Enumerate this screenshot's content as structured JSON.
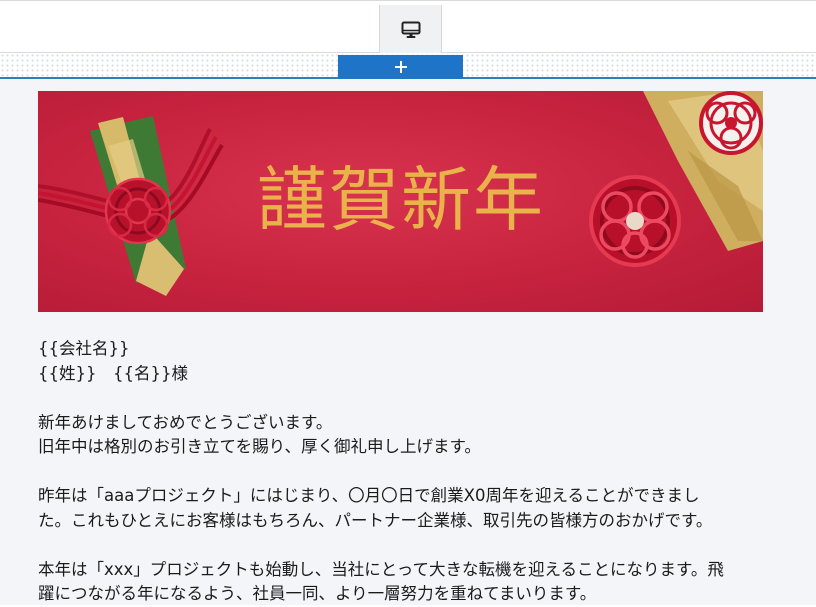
{
  "toolbar": {
    "device_icon": "desktop-monitor-icon",
    "add_icon": "plus-icon",
    "add_symbol": "+"
  },
  "banner": {
    "title": "謹賀新年",
    "title_color": "#e9b24a",
    "background_color": "#c7233f"
  },
  "letter": {
    "company_line": "{{会社名}}",
    "name_line": "{{姓}}　{{名}}様",
    "paragraph1": [
      "新年あけましておめでとうございます。",
      "旧年中は格別のお引き立てを賜り、厚く御礼申し上げます。"
    ],
    "paragraph2": [
      "昨年は「aaaプロジェクト」にはじまり、〇月〇日で創業X0周年を迎えることができまし",
      "た。これもひとえにお客様はもちろん、パートナー企業様、取引先の皆様方のおかげです。"
    ],
    "paragraph3": [
      "本年は「xxx」プロジェクトも始動し、当社にとって大きな転機を迎えることになります。飛",
      "躍につながる年になるよう、社員一同、より一層努力を重ねてまいります。"
    ]
  },
  "colors": {
    "accent": "#1e74c6",
    "canvas_background": "#f4f5f8"
  }
}
